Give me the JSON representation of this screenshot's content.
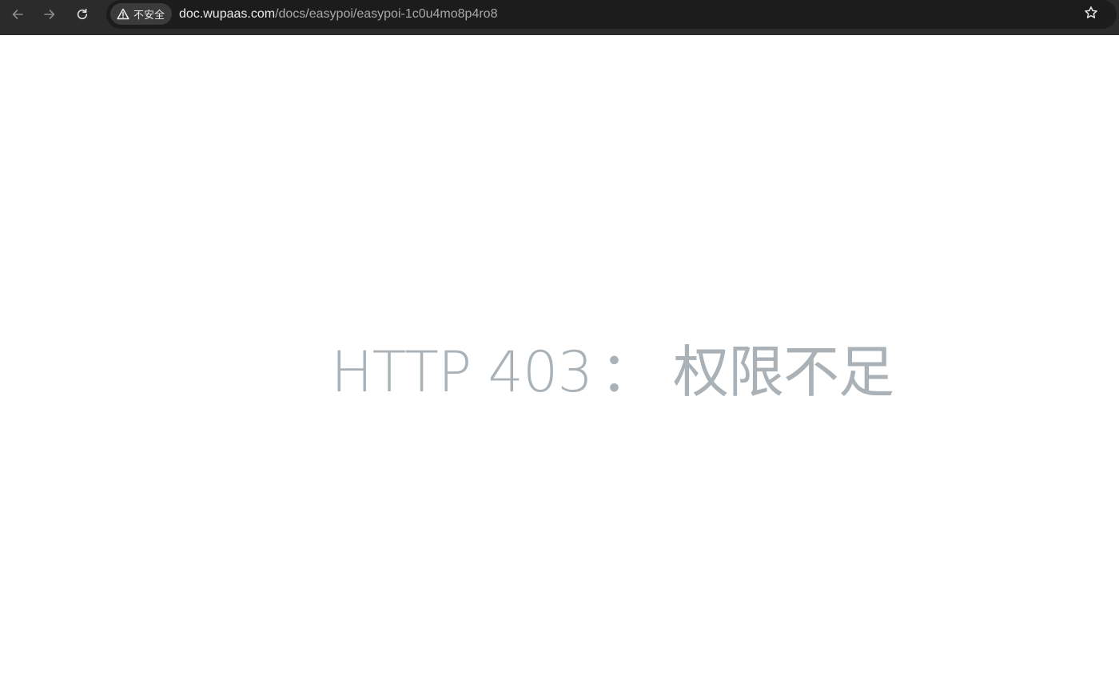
{
  "browser": {
    "nav": {
      "back_icon": "arrow-left-icon",
      "forward_icon": "arrow-right-icon",
      "reload_icon": "reload-icon"
    },
    "omnibox": {
      "security_label": "不安全",
      "security_icon": "warning-triangle-icon",
      "url_host": "doc.wupaas.com",
      "url_path": "/docs/easypoi/easypoi-1c0u4mo8p4ro8",
      "bookmark_icon": "star-outline-icon"
    },
    "colors": {
      "toolbar_bg": "#2b2b2b",
      "omnibox_bg": "#1c1c1c",
      "chip_bg": "#3b3b3b"
    }
  },
  "page": {
    "error_code": "HTTP 403",
    "separator": "：",
    "error_text": "权限不足",
    "text_color": "#aab2b7"
  }
}
